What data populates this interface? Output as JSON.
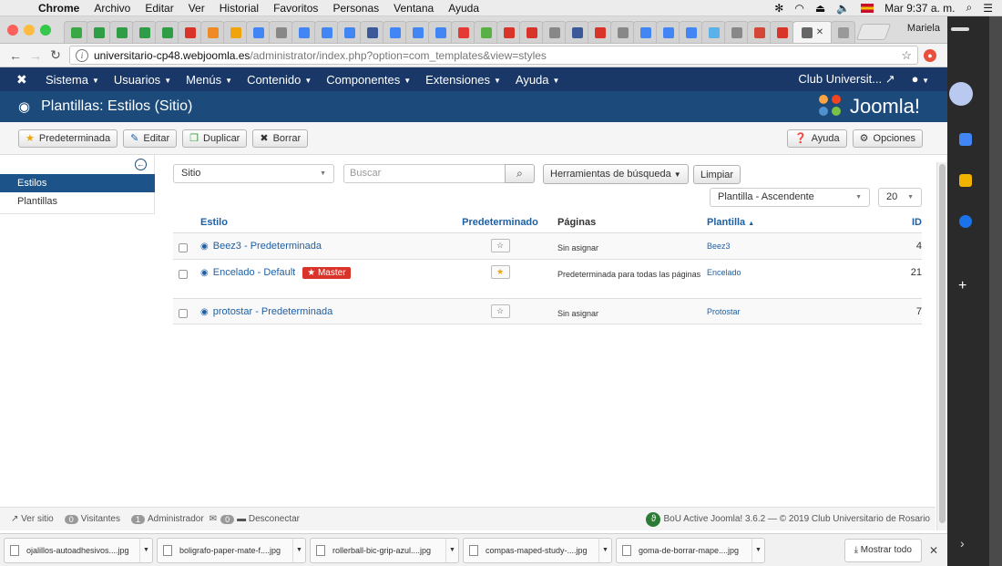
{
  "macos": {
    "app": "Chrome",
    "menus": [
      "Archivo",
      "Editar",
      "Ver",
      "Historial",
      "Favoritos",
      "Personas",
      "Ventana",
      "Ayuda"
    ],
    "clock": "Mar 9:37 a. m."
  },
  "browser": {
    "profile": "Mariela",
    "url_host": "universitario-cp48.webjoomla.es",
    "url_path": "/administrator/index.php?option=com_templates&view=styles",
    "tab_favicon_colors": [
      "#3aa845",
      "#2f9d46",
      "#2f9d46",
      "#2f9d46",
      "#2f9d46",
      "#d9342a",
      "#f08a24",
      "#f0a30a",
      "#4285f4",
      "#888888",
      "#4285f4",
      "#4285f4",
      "#4285f4",
      "#3b5998",
      "#4285f4",
      "#4285f4",
      "#4285f4",
      "#e53935",
      "#5ab047",
      "#d9342a",
      "#d9342a",
      "#888888",
      "#3b5998",
      "#d9342a",
      "#888888",
      "#4285f4",
      "#4285f4",
      "#4285f4",
      "#5ab2e8",
      "#888888",
      "#d44638",
      "#d9342a"
    ]
  },
  "joomla": {
    "nav": {
      "menus": [
        "Sistema",
        "Usuarios",
        "Menús",
        "Contenido",
        "Componentes",
        "Extensiones",
        "Ayuda"
      ],
      "site_link": "Club Universit...",
      "user_icon": "user-icon"
    },
    "header": {
      "title": "Plantillas: Estilos (Sitio)",
      "brand": "Joomla!"
    },
    "toolbar": {
      "default_label": "Predeterminada",
      "edit_label": "Editar",
      "duplicate_label": "Duplicar",
      "delete_label": "Borrar",
      "help_label": "Ayuda",
      "options_label": "Opciones"
    },
    "sidebar": {
      "items": [
        "Estilos",
        "Plantillas"
      ]
    },
    "filters": {
      "client_value": "Sitio",
      "search_placeholder": "Buscar",
      "search_tools_label": "Herramientas de búsqueda",
      "clear_label": "Limpiar",
      "sort_value": "Plantilla - Ascendente",
      "limit_value": "20"
    },
    "columns": {
      "style": "Estilo",
      "default": "Predeterminado",
      "pages": "Páginas",
      "template": "Plantilla",
      "sort_indicator": "▲",
      "id": "ID"
    },
    "rows": [
      {
        "style": "Beez3 - Predeterminada",
        "badge": "",
        "pages": "Sin asignar",
        "template": "Beez3",
        "id": "4",
        "is_default": false
      },
      {
        "style": "Enceladо - Default",
        "badge": "★ Master",
        "pages": "Predeterminada para todas las páginas",
        "template": "Encelado",
        "id": "21",
        "is_default": true
      },
      {
        "style": "protostar - Predeterminada",
        "badge": "",
        "pages": "Sin asignar",
        "template": "Protostar",
        "id": "7",
        "is_default": false
      }
    ],
    "status": {
      "view_site": "Ver sitio",
      "visitors_count": "0",
      "visitors_label": "Visitantes",
      "admin_count": "1",
      "admin_label": "Administrador",
      "msg_count": "0",
      "logout_label": "Desconectar",
      "footer": "BoU Active Joomla! 3.6.2  —  © 2019 Club Universitario de Rosario"
    }
  },
  "downloads": {
    "files": [
      "ojalillos-autoadhesivos....jpg",
      "boligrafo-paper-mate-f....jpg",
      "rollerball-bic-grip-azul....jpg",
      "compas-maped-study-....jpg",
      "goma-de-borrar-mape....jpg"
    ],
    "show_all": "Mostrar todo"
  }
}
